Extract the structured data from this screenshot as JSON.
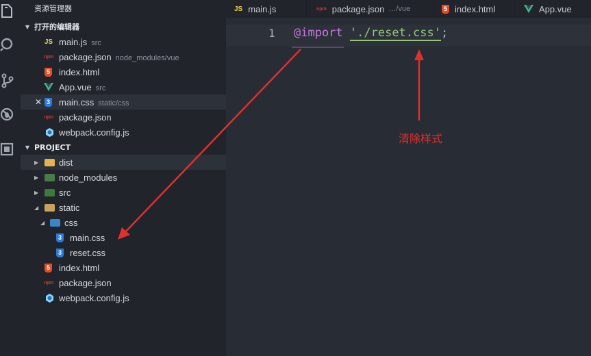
{
  "sidebar": {
    "title": "资源管理器",
    "open_editors": {
      "header": "打开的编辑器",
      "items": [
        {
          "icon": "JS",
          "name": "main.js",
          "desc": "src"
        },
        {
          "icon": "npm",
          "name": "package.json",
          "desc": "node_modules/vue"
        },
        {
          "icon": "5",
          "name": "index.html",
          "desc": ""
        },
        {
          "icon": "vue",
          "name": "App.vue",
          "desc": "src"
        },
        {
          "icon": "3",
          "name": "main.css",
          "desc": "static/css",
          "close": "✕"
        },
        {
          "icon": "npm",
          "name": "package.json",
          "desc": ""
        },
        {
          "icon": "webpack",
          "name": "webpack.config.js",
          "desc": ""
        }
      ]
    },
    "project": {
      "header": "PROJECT",
      "items": [
        {
          "name": "dist"
        },
        {
          "name": "node_modules"
        },
        {
          "name": "src"
        },
        {
          "name": "static"
        },
        {
          "name": "css"
        },
        {
          "icon": "3",
          "name": "main.css"
        },
        {
          "icon": "3",
          "name": "reset.css"
        },
        {
          "icon": "5",
          "name": "index.html"
        },
        {
          "icon": "npm",
          "name": "package.json"
        },
        {
          "icon": "webpack",
          "name": "webpack.config.js"
        }
      ]
    }
  },
  "tabs": [
    {
      "icon": "JS",
      "label": "main.js",
      "desc": ""
    },
    {
      "icon": "npm",
      "label": "package.json",
      "desc": "…/vue"
    },
    {
      "icon": "5",
      "label": "index.html",
      "desc": ""
    },
    {
      "icon": "vue",
      "label": "App.vue",
      "desc": ""
    }
  ],
  "editor": {
    "line_number": "1",
    "tokens": {
      "keyword": "@import",
      "space": " ",
      "string": "'./reset.css'",
      "semicolon": ";"
    }
  },
  "annotation": "清除样式",
  "colors": {
    "arrow": "#e0302c",
    "keyword": "#c678dd",
    "string": "#98c379"
  }
}
